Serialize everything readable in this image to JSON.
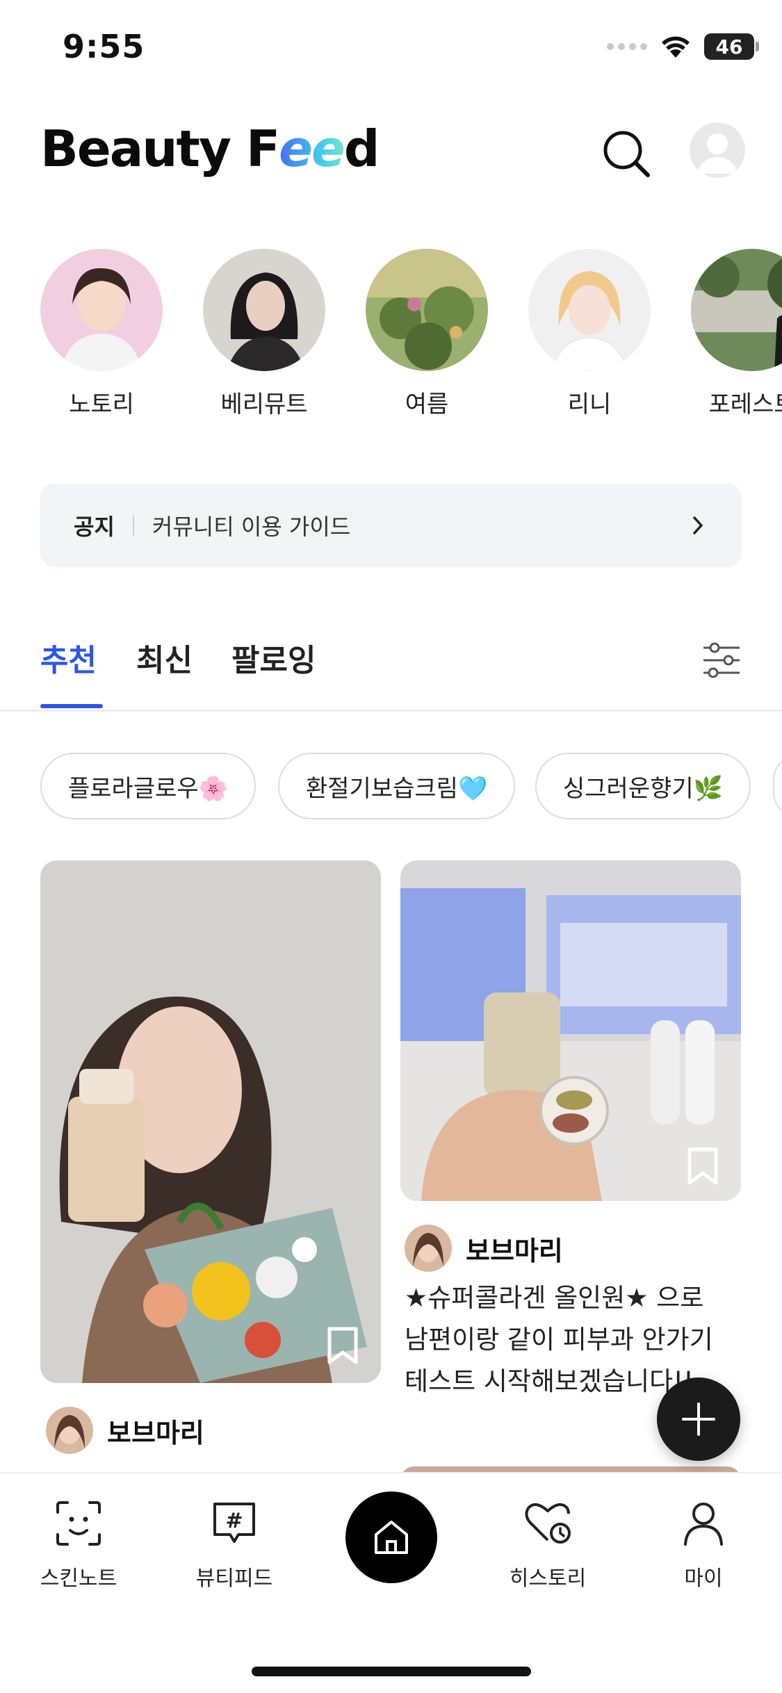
{
  "status_bar": {
    "time": "9:55",
    "battery": "46"
  },
  "header": {
    "logo_prefix": "Beauty F",
    "logo_ee": "ee",
    "logo_suffix": "d"
  },
  "stories": [
    {
      "name": "노토리"
    },
    {
      "name": "베리뮤트"
    },
    {
      "name": "여름"
    },
    {
      "name": "리니"
    },
    {
      "name": "포레스트"
    }
  ],
  "notice": {
    "tag": "공지",
    "text": "커뮤니티 이용 가이드"
  },
  "tabs": [
    {
      "label": "추천",
      "active": true
    },
    {
      "label": "최신",
      "active": false
    },
    {
      "label": "팔로잉",
      "active": false
    }
  ],
  "chips": [
    {
      "label": "플로라글로우🌸"
    },
    {
      "label": "환절기보습크림🩵"
    },
    {
      "label": "싱그러운향기🌿"
    }
  ],
  "posts": [
    {
      "author": "보브마리",
      "text": "★슈퍼콜라겐 올인원★ 으로\n남편이랑 같이 피부과 안가기\n테스트 시작해보겠습니다!!…"
    },
    {
      "author": "보브마리",
      "text": ""
    }
  ],
  "bottom_nav": {
    "items": [
      {
        "label": "스킨노트",
        "icon": "face-scan-icon"
      },
      {
        "label": "뷰티피드",
        "icon": "hashtag-chat-icon"
      },
      {
        "label": "",
        "icon": "home-icon"
      },
      {
        "label": "히스토리",
        "icon": "heart-history-icon"
      },
      {
        "label": "마이",
        "icon": "person-icon"
      }
    ]
  },
  "colors": {
    "accent": "#2b57e6",
    "chip_border": "#dcdde1",
    "notice_bg": "#f3f4f6"
  }
}
